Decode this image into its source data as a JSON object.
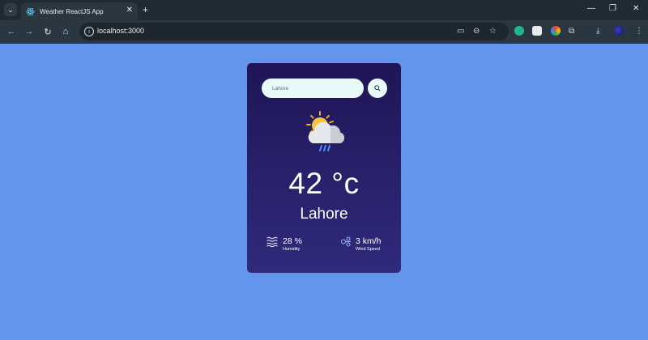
{
  "browser": {
    "tab_title": "Weather ReactJS App",
    "url": "localhost:3000",
    "colors": {
      "tabbar": "#1f2a33",
      "toolbar": "#2b3740",
      "omnibox": "#1d262d"
    }
  },
  "page": {
    "background": "#6495ed",
    "search": {
      "value": "Lahore"
    },
    "weather": {
      "icon": "sun-cloud-rain-icon",
      "temperature": "42 °c",
      "city": "Lahore",
      "humidity_value": "28 %",
      "humidity_label": "Humidity",
      "wind_value": "3 km/h",
      "wind_label": "Wind Speed"
    },
    "colors": {
      "card_top": "#1f1556",
      "card_bottom": "#302a7b",
      "input_bg": "#e8fbf9"
    }
  }
}
